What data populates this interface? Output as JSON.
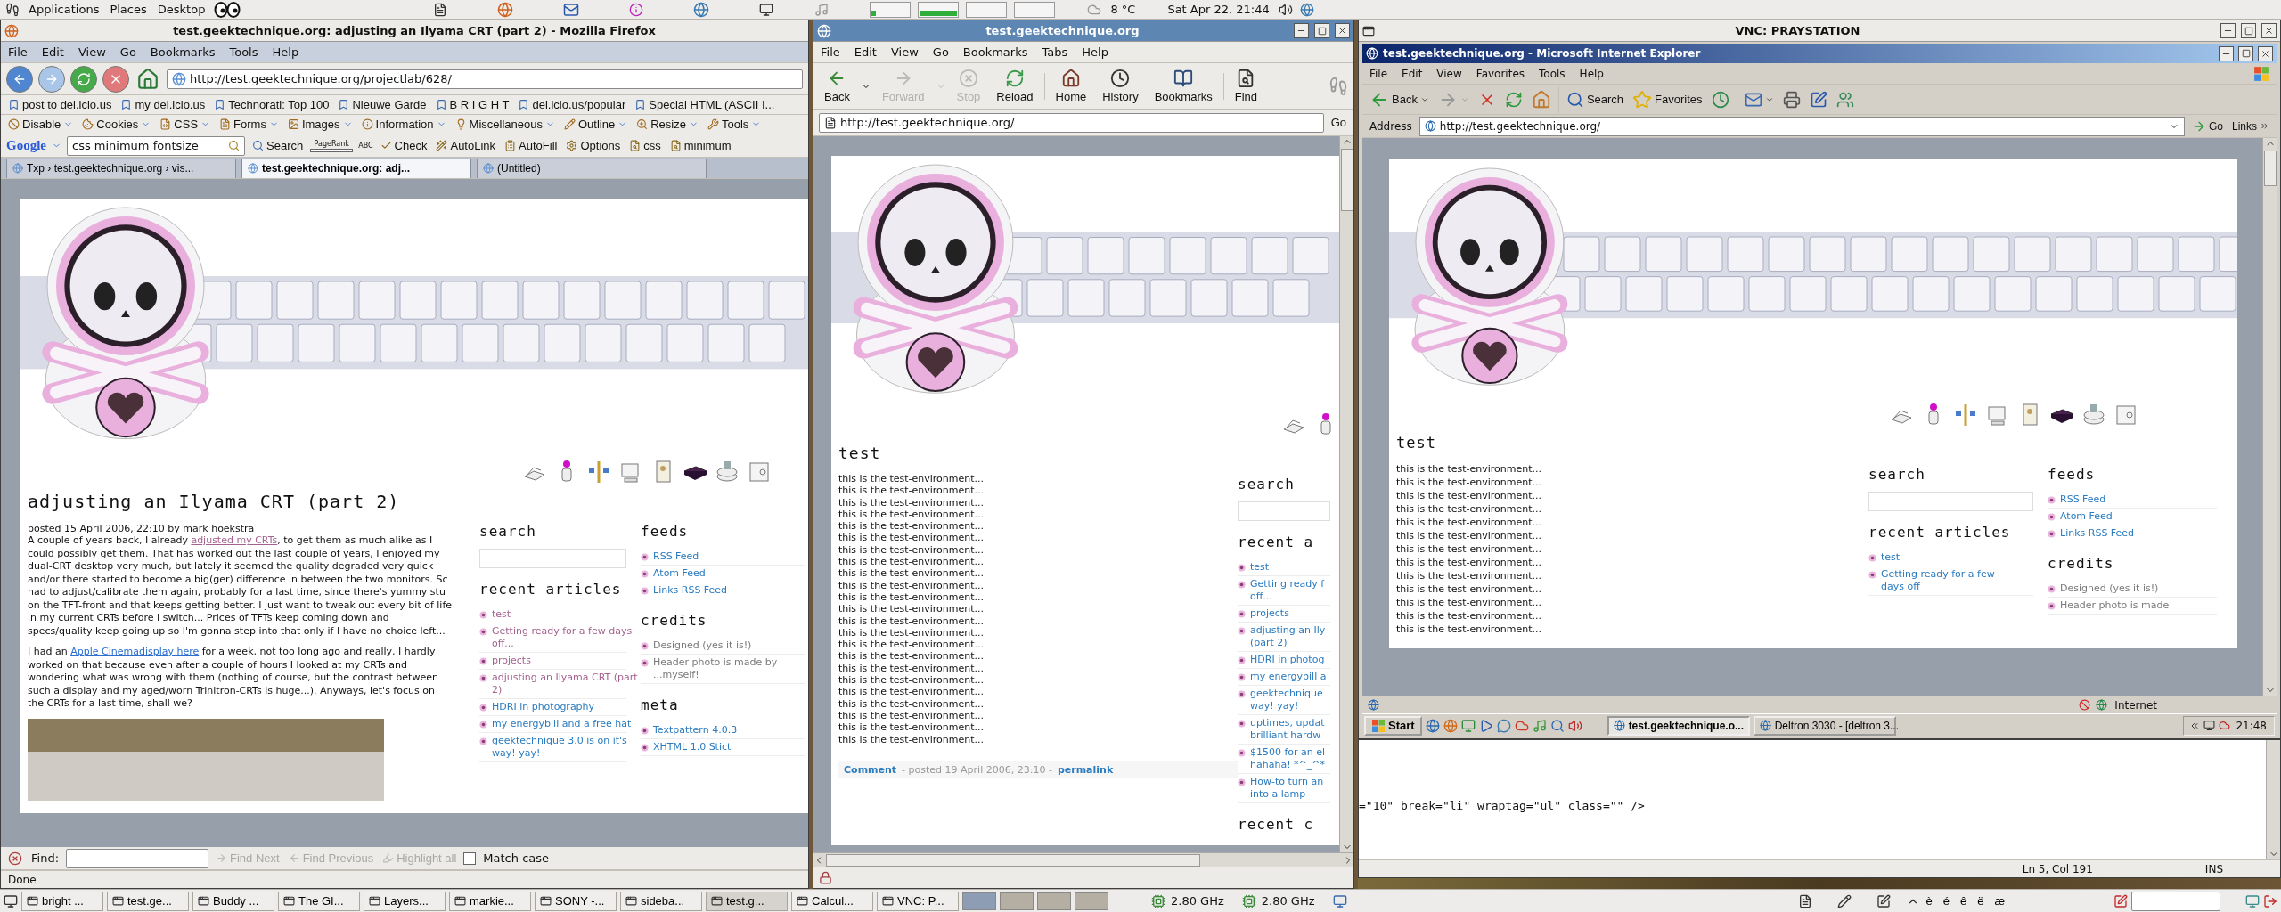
{
  "top_panel": {
    "menus": [
      "Applications",
      "Places",
      "Desktop"
    ],
    "weather": "8 °C",
    "clock": "Sat Apr 22, 21:44"
  },
  "firefox": {
    "focused": false,
    "title": "test.geektechnique.org: adjusting an Ilyama CRT (part 2) - Mozilla Firefox",
    "menu": [
      "File",
      "Edit",
      "View",
      "Go",
      "Bookmarks",
      "Tools",
      "Help"
    ],
    "url": "http://test.geektechnique.org/projectlab/628/",
    "bookmarks": [
      "post to del.icio.us",
      "my del.icio.us",
      "Technorati: Top 100",
      "Nieuwe Garde",
      "B R I G H T",
      "del.icio.us/popular",
      "Special HTML (ASCII I..."
    ],
    "webdev": [
      "Disable",
      "Cookies",
      "CSS",
      "Forms",
      "Images",
      "Information",
      "Miscellaneous",
      "Outline",
      "Resize",
      "Tools"
    ],
    "google": {
      "logo": "Google",
      "query": "css minimum fontsize",
      "pagerank": "PageRank",
      "spell_note": "ABC",
      "buttons": [
        "Search",
        "Check",
        "AutoLink",
        "AutoFill",
        "Options",
        "css",
        "minimum"
      ]
    },
    "tabs": [
      {
        "label": "Txp › test.geektechnique.org › vis...",
        "selected": false
      },
      {
        "label": "test.geektechnique.org: adj...",
        "selected": true
      },
      {
        "label": "(Untitled)",
        "selected": false
      }
    ],
    "page": {
      "heading": "adjusting an Ilyama CRT (part 2)",
      "meta": "posted 15 April 2006, 22:10 by mark hoekstra",
      "paragraphs": [
        [
          [
            {
              "text": "A couple of years back, I already "
            },
            {
              "text": "adjusted my CRTs",
              "visited": true
            },
            {
              "text": ", to get them as much alike as I"
            }
          ],
          [
            {
              "text": "could possibly get them. That has worked out the last couple of years, I enjoyed my"
            }
          ],
          [
            {
              "text": "dual-CRT desktop very much, but lately it seemed the quality degraded very quick"
            }
          ],
          [
            {
              "text": "and/or there started to become a big(ger) difference in between the two monitors. Sc"
            }
          ],
          [
            {
              "text": "had to adjust/calibrate them again, probably for a last time, since there's yummy stu"
            }
          ],
          [
            {
              "text": "on the TFT-front and that keeps getting better. I just want to tweak out every bit of life"
            }
          ],
          [
            {
              "text": "in my current CRTs before I switch... Prices of TFTs keep coming down and"
            }
          ],
          [
            {
              "text": "specs/quality keep going up so I'm gonna step into that only if I have no choice left..."
            }
          ]
        ],
        [
          [
            {
              "text": "I had an "
            },
            {
              "text": "Apple Cinemadisplay here",
              "visited": false
            },
            {
              "text": " for a week, not too long ago and really, I hardly"
            }
          ],
          [
            {
              "text": "worked on that because even after a couple of hours I looked at my CRTs and"
            }
          ],
          [
            {
              "text": "wondering what was wrong with them (nothing of course, but the contrast between"
            }
          ],
          [
            {
              "text": "such a display and my aged/worn Trinitron-CRTs is huge...). Anyways, let's focus on"
            }
          ],
          [
            {
              "text": "the CRTs for a last time, shall we?"
            }
          ]
        ]
      ],
      "sidebar": [
        [
          {
            "title": "search",
            "kind": "search"
          },
          {
            "title": "recent articles",
            "kind": "links",
            "items": [
              {
                "text": "test",
                "visited": true
              },
              {
                "text": "Getting ready for a few days\noff...",
                "visited": true
              },
              {
                "text": "projects",
                "visited": true
              },
              {
                "text": "adjusting an Ilyama CRT (part\n2)",
                "visited": true
              },
              {
                "text": "HDRI in photography",
                "visited": false
              },
              {
                "text": "my energybill and a free hat",
                "visited": false
              },
              {
                "text": "geektechnique 3.0 is on it's\nway! yay!",
                "visited": false
              }
            ]
          }
        ],
        [
          {
            "title": "feeds",
            "kind": "links",
            "items": [
              {
                "text": "RSS Feed",
                "visited": false
              },
              {
                "text": "Atom Feed",
                "visited": false
              },
              {
                "text": "Links RSS Feed",
                "visited": false
              }
            ]
          },
          {
            "title": "credits",
            "kind": "plain",
            "items": [
              {
                "text": "Designed (yes it is!)"
              },
              {
                "text": "Header photo is made by\n...myself!"
              }
            ]
          },
          {
            "title": "meta",
            "kind": "links",
            "items": [
              {
                "text": "Textpattern 4.0.3",
                "visited": false
              },
              {
                "text": "XHTML 1.0 Stict",
                "visited": false
              }
            ]
          }
        ]
      ]
    },
    "find": {
      "label": "Find:",
      "buttons": [
        {
          "label": "Find Next",
          "disabled": true
        },
        {
          "label": "Find Previous",
          "disabled": true
        },
        {
          "label": "Highlight all",
          "disabled": true
        }
      ],
      "match_case": {
        "label": "Match case",
        "checked": false
      }
    },
    "status": "Done"
  },
  "epiphany": {
    "focused": true,
    "title": "test.geektechnique.org",
    "menu": [
      "File",
      "Edit",
      "View",
      "Go",
      "Bookmarks",
      "Tabs",
      "Help"
    ],
    "toolbar": [
      {
        "label": "Back",
        "disabled": false
      },
      {
        "label": "Forward",
        "disabled": true
      },
      {
        "label": "Stop",
        "disabled": true
      },
      {
        "label": "Reload",
        "disabled": false
      },
      {
        "label": "Home",
        "disabled": false
      },
      {
        "label": "History",
        "disabled": false
      },
      {
        "label": "Bookmarks",
        "disabled": false
      },
      {
        "label": "Find",
        "disabled": false
      }
    ],
    "url": "http://test.geektechnique.org/",
    "go": "Go",
    "page": {
      "heading": "test",
      "lines": [
        "this is the test-environment...",
        "this is the test-environment...",
        "this is the test-environment...",
        "this is the test-environment...",
        "this is the test-environment...",
        "this is the test-environment...",
        "this is the test-environment...",
        "this is the test-environment...",
        "this is the test-environment...",
        "this is the test-environment...",
        "this is the test-environment...",
        "this is the test-environment...",
        "this is the test-environment...",
        "this is the test-environment...",
        "this is the test-environment...",
        "this is the test-environment...",
        "this is the test-environment...",
        "this is the test-environment...",
        "this is the test-environment...",
        "this is the test-environment...",
        "this is the test-environment...",
        "this is the test-environment...",
        "this is the test-environment..."
      ],
      "footer": {
        "comment": "Comment",
        "posted": "- posted 19 April 2006, 23:10 -",
        "permalink": "permalink"
      },
      "sidebar": [
        [
          {
            "title": "search",
            "kind": "search"
          },
          {
            "title": "recent a",
            "kind": "links",
            "items": [
              {
                "text": "test",
                "visited": false
              },
              {
                "text": "Getting ready f\noff...",
                "visited": false
              },
              {
                "text": "projects",
                "visited": false
              },
              {
                "text": "adjusting an Ily\n(part 2)",
                "visited": false
              },
              {
                "text": "HDRI in photog",
                "visited": false
              },
              {
                "text": "my energybill a",
                "visited": false
              },
              {
                "text": "geektechnique\nway! yay!",
                "visited": false
              },
              {
                "text": "uptimes, updat\nbrilliant hardw",
                "visited": false
              },
              {
                "text": "$1500 for an el\nhahaha! *^_^*",
                "visited": false
              },
              {
                "text": "How-to turn an\ninto a lamp",
                "visited": false
              }
            ]
          },
          {
            "title": "recent c",
            "kind": "heading"
          }
        ]
      ]
    }
  },
  "vnc": {
    "focused": false,
    "title": "VNC: PRAYSTATION",
    "ie": {
      "focused": true,
      "title": "test.geektechnique.org - Microsoft Internet Explorer",
      "menu": [
        "File",
        "Edit",
        "View",
        "Favorites",
        "Tools",
        "Help"
      ],
      "toolbar": [
        "Back",
        "Search",
        "Favorites"
      ],
      "address_label": "Address",
      "url": "http://test.geektechnique.org/",
      "go": "Go",
      "links": "Links",
      "page": {
        "heading": "test",
        "lines": [
          "this is the test-environment...",
          "this is the test-environment...",
          "this is the test-environment...",
          "this is the test-environment...",
          "this is the test-environment...",
          "this is the test-environment...",
          "this is the test-environment...",
          "this is the test-environment...",
          "this is the test-environment...",
          "this is the test-environment...",
          "this is the test-environment...",
          "this is the test-environment...",
          "this is the test-environment..."
        ],
        "sidebar": [
          [
            {
              "title": "search",
              "kind": "search"
            },
            {
              "title": "recent articles",
              "kind": "links",
              "items": [
                {
                  "text": "test",
                  "visited": false
                },
                {
                  "text": "Getting ready for a few\ndays off",
                  "visited": false
                }
              ]
            }
          ],
          [
            {
              "title": "feeds",
              "kind": "links",
              "items": [
                {
                  "text": "RSS Feed",
                  "visited": false
                },
                {
                  "text": "Atom Feed",
                  "visited": false
                },
                {
                  "text": "Links RSS Feed",
                  "visited": false
                }
              ]
            },
            {
              "title": "credits",
              "kind": "plain",
              "items": [
                {
                  "text": "Designed (yes it is!)"
                },
                {
                  "text": "Header photo is made"
                }
              ]
            }
          ]
        ]
      },
      "status": "Internet"
    },
    "xp_taskbar": {
      "start": "Start",
      "tasks": [
        {
          "label": "test.geektechnique.o...",
          "selected": true
        },
        {
          "label": "Deltron 3030 - [deltron 3...",
          "selected": false
        }
      ],
      "clock": "21:48"
    }
  },
  "editor": {
    "code": "=\"10\" break=\"li\" wraptag=\"ul\" class=\"\" />",
    "position": "Ln 5, Col 191",
    "mode": "INS"
  },
  "bottom_panel": {
    "tasks": [
      {
        "label": "bright ...",
        "selected": false
      },
      {
        "label": "test.ge...",
        "selected": false
      },
      {
        "label": "Buddy ...",
        "selected": false
      },
      {
        "label": "The GI...",
        "selected": false
      },
      {
        "label": "Layers...",
        "selected": false
      },
      {
        "label": "markie...",
        "selected": false
      },
      {
        "label": "SONY -...",
        "selected": false
      },
      {
        "label": "sideba...",
        "selected": false
      },
      {
        "label": "test.g...",
        "selected": true
      },
      {
        "label": "Calcul...",
        "selected": false
      },
      {
        "label": "VNC: P...",
        "selected": false
      }
    ],
    "cpus": [
      "2.80 GHz",
      "2.80 GHz"
    ],
    "characters": [
      "è",
      "é",
      "ê",
      "ë",
      "æ"
    ]
  }
}
